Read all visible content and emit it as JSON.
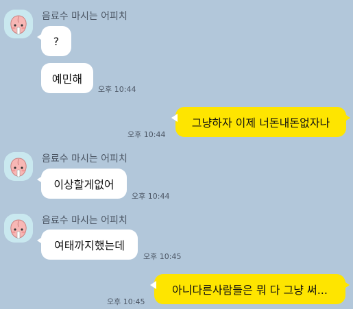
{
  "chat": {
    "sender_name": "음료수 마시는 어피치",
    "messages": [
      {
        "text": "?",
        "time": ""
      },
      {
        "text": "예민해",
        "time": "오후 10:44"
      },
      {
        "text": "그냥하자 이제 너돈내돈없자나",
        "time": "오후 10:44"
      },
      {
        "text": "이상할게없어",
        "time": "오후 10:44"
      },
      {
        "text": "여태까지했는데",
        "time": "오후 10:45"
      },
      {
        "text": "아니다른사람들은 뭐 다 그냥 써...",
        "time": "오후 10:45"
      }
    ]
  },
  "avatar_icon": "apeach-profile-icon",
  "colors": {
    "background": "#b2c7da",
    "received_bubble": "#ffffff",
    "sent_bubble": "#fee500"
  }
}
